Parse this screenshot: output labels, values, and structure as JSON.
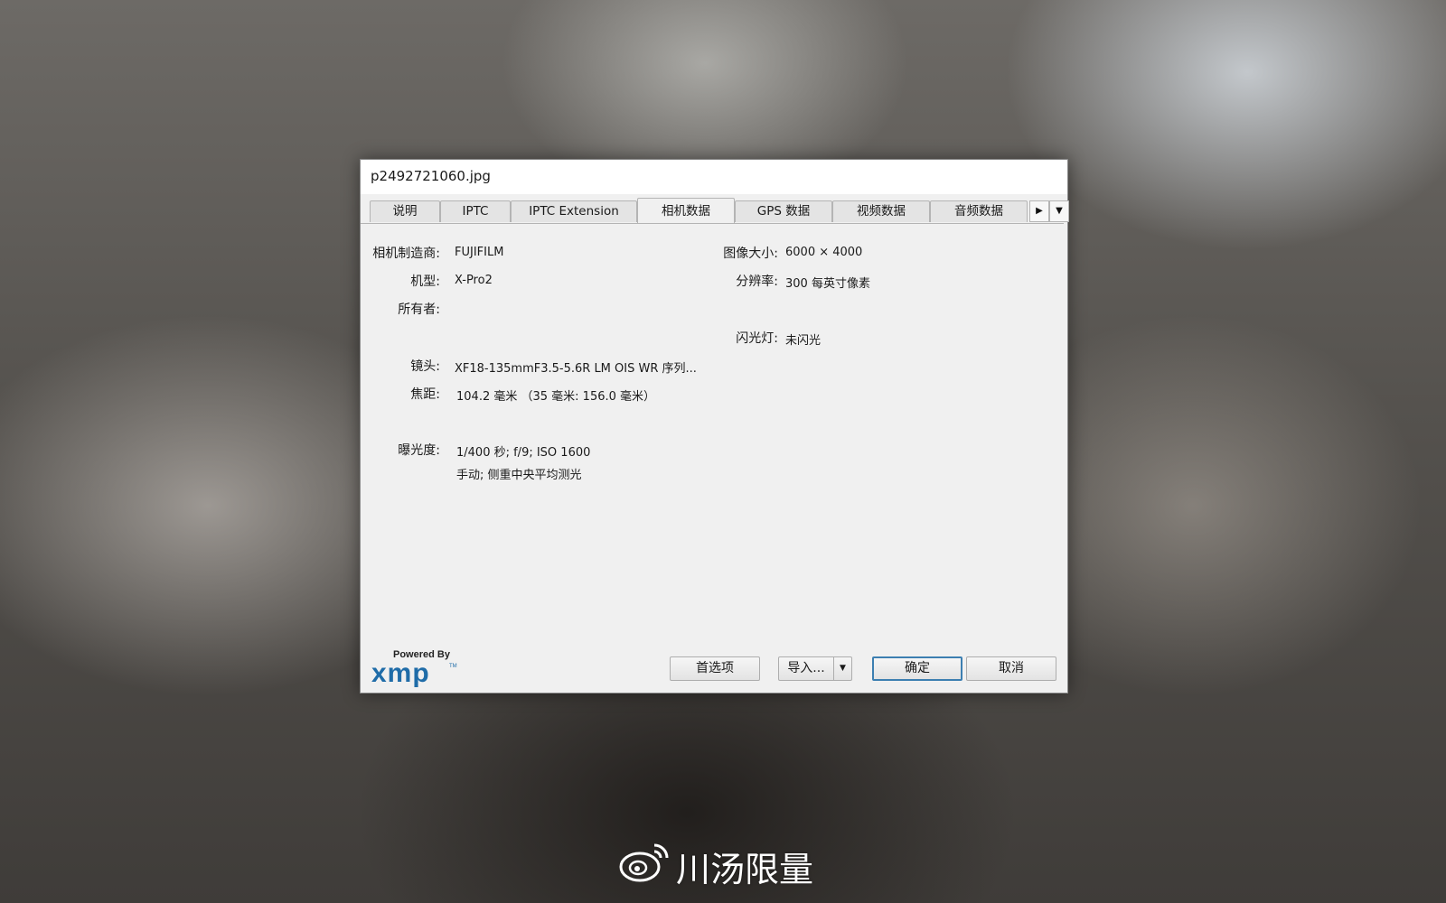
{
  "dialog": {
    "title": "p2492721060.jpg",
    "tabs": [
      {
        "label": "说明"
      },
      {
        "label": "IPTC"
      },
      {
        "label": "IPTC Extension"
      },
      {
        "label": "相机数据"
      },
      {
        "label": "GPS 数据"
      },
      {
        "label": "视频数据"
      },
      {
        "label": "音频数据"
      }
    ],
    "active_tab": "相机数据",
    "tab_scroll_right_icon": "triangle-right",
    "tab_menu_icon": "triangle-down"
  },
  "fields": {
    "make_label": "相机制造商:",
    "make_value": "FUJIFILM",
    "model_label": "机型:",
    "model_value": "X-Pro2",
    "owner_label": "所有者:",
    "lens_label": "镜头:",
    "lens_value": "XF18-135mmF3.5-5.6R LM OIS WR   序列...",
    "focal_label": "焦距:",
    "focal_value": "104.2 毫米  （35 毫米: 156.0 毫米）",
    "exposure_label": "曝光度:",
    "exposure_value_1": "1/400 秒;  f/9;  ISO 1600",
    "exposure_value_2": "手动;  侧重中央平均测光",
    "size_label": "图像大小:",
    "size_value": "6000 × 4000",
    "resolution_label": "分辨率:",
    "resolution_value": "300 每英寸像素",
    "flash_label": "闪光灯:",
    "flash_value": "未闪光"
  },
  "footer": {
    "powered_by": "Powered By",
    "logo_text": "xmp",
    "logo_tm": "TM",
    "preferences_button": "首选项",
    "import_button": "导入...",
    "ok_button": "确定",
    "cancel_button": "取消"
  },
  "watermark": {
    "text": "川汤限量",
    "icon": "weibo-icon"
  },
  "colors": {
    "dialog_bg": "#f0f0f0",
    "accent_border": "#3c7fb1",
    "xmp_blue": "#1f6ca8"
  }
}
